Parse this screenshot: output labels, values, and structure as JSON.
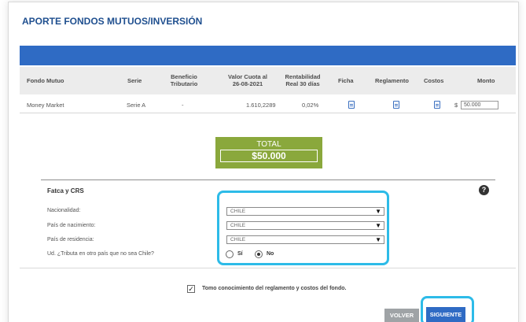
{
  "header": {
    "title": "APORTE FONDOS MUTUOS/INVERSIÓN"
  },
  "table": {
    "columns": {
      "fondo": "Fondo Mutuo",
      "serie": "Serie",
      "beneficio_1": "Beneficio",
      "beneficio_2": "Tributario",
      "valor_1": "Valor Cuota al",
      "valor_2": "26-08-2021",
      "rent_1": "Rentabilidad",
      "rent_2": "Real 30 días",
      "ficha": "Ficha",
      "reglamento": "Reglamento",
      "costos": "Costos",
      "monto": "Monto"
    },
    "row": {
      "fondo": "Money Market",
      "serie": "Serie A",
      "beneficio": "-",
      "valor_cuota": "1.610,2289",
      "rentabilidad": "0,02%",
      "currency": "$",
      "monto": "50.000"
    }
  },
  "total": {
    "label": "TOTAL",
    "value": "$50.000"
  },
  "fatca": {
    "title": "Fatca y CRS",
    "help": "?",
    "nacionalidad_label": "Nacionalidad:",
    "nacionalidad_value": "CHILE",
    "pais_nacimiento_label": "País de nacimiento:",
    "pais_nacimiento_value": "CHILE",
    "pais_residencia_label": "País de residencia:",
    "pais_residencia_value": "CHILE",
    "tributa_label": "Ud. ¿Tributa en otro país que no sea Chile?",
    "option_si": "Sí",
    "option_no": "No",
    "selected": "No"
  },
  "terms": {
    "text": "Tomo conocimiento del reglamento y costos del fondo.",
    "checked": true,
    "check_mark": "✓"
  },
  "buttons": {
    "back": "VOLVER",
    "next": "SIGUIENTE"
  },
  "glyphs": {
    "dropdown": "▼"
  },
  "colors": {
    "brand_blue": "#2f6bc4",
    "title_blue": "#1f4f8f",
    "total_green": "#8aa83c",
    "highlight": "#2dbbe8",
    "button_gray": "#9fa3a6"
  }
}
